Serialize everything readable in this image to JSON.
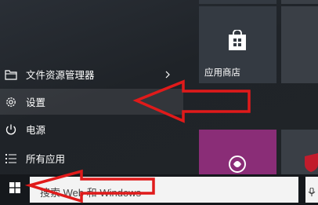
{
  "menu": {
    "items": [
      {
        "id": "file-explorer",
        "label": "文件资源管理器",
        "icon": "folder-icon",
        "has_submenu": true
      },
      {
        "id": "settings",
        "label": "设置",
        "icon": "gear-icon",
        "highlighted": true
      },
      {
        "id": "power",
        "label": "电源",
        "icon": "power-icon"
      },
      {
        "id": "all-apps",
        "label": "所有应用",
        "icon": "list-icon"
      }
    ]
  },
  "tiles": {
    "store": {
      "label": "应用商店",
      "icon": "store-bag-icon",
      "color": "#343a42"
    },
    "magenta_tile": {
      "icon": "app-logo-icon",
      "color": "#8a2d77"
    },
    "right_top_tile": {
      "color": "#3a3f46"
    },
    "right_bottom_tile": {
      "icon": "shield-icon",
      "color": "#3a3f46"
    }
  },
  "taskbar": {
    "start_icon": "windows-logo-icon",
    "search_placeholder": "搜索 Web 和 Windows"
  },
  "annotations": {
    "arrow_color": "#e01a1a"
  }
}
